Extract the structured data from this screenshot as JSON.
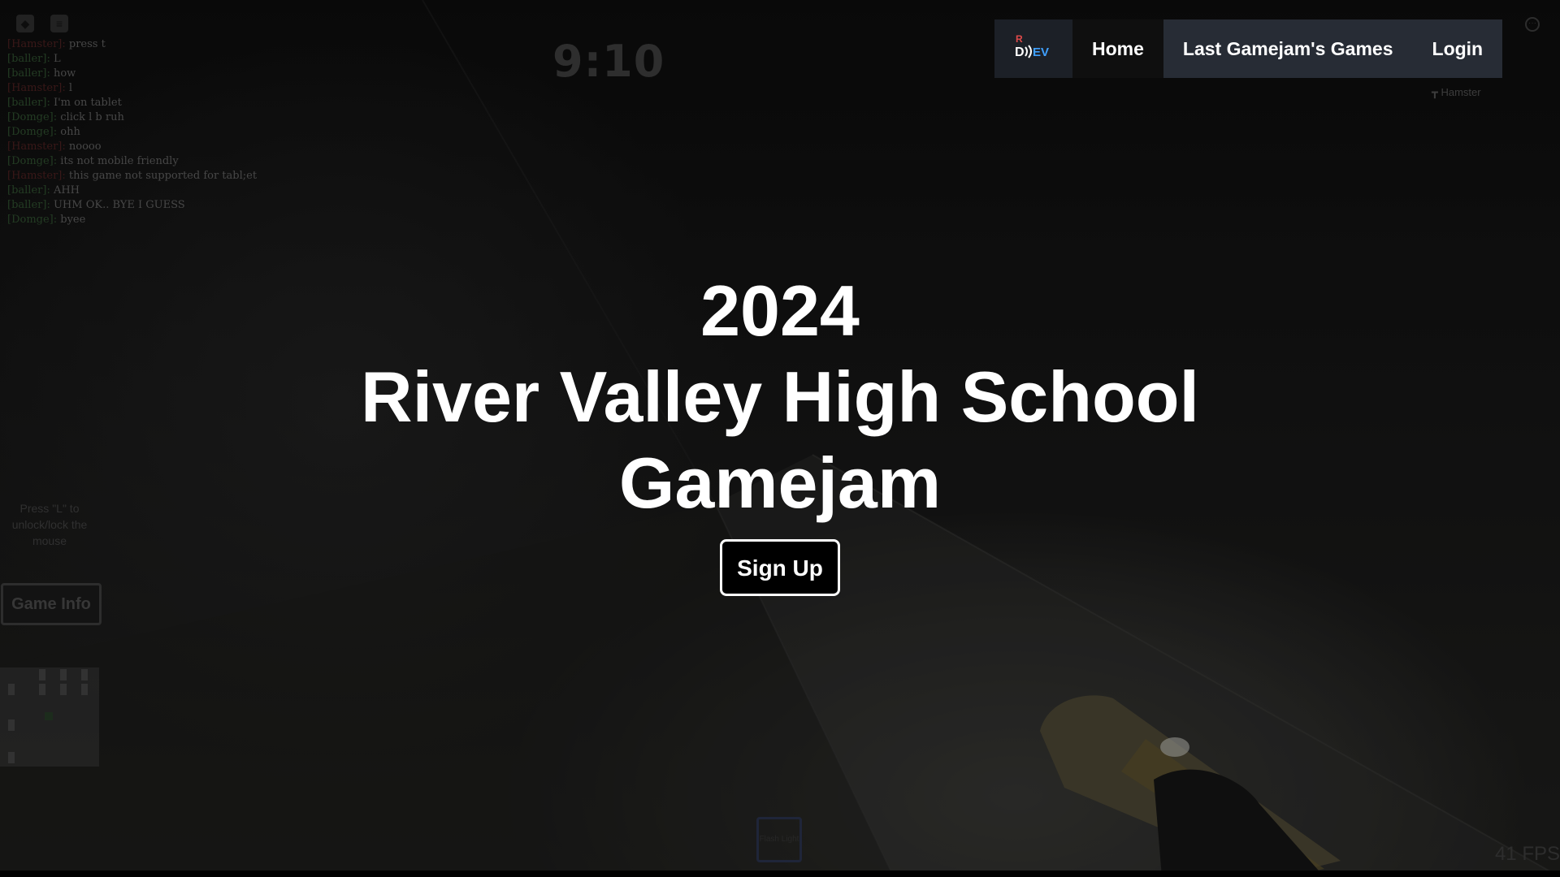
{
  "nav": {
    "logo_label": "R D)EV",
    "items": [
      {
        "label": "Home"
      },
      {
        "label": "Last Gamejam's Games"
      },
      {
        "label": "Login"
      }
    ]
  },
  "hero": {
    "year": "2024",
    "title_line1": "River Valley High School",
    "title_line2": "Gamejam",
    "signup_label": "Sign Up"
  },
  "game_scene": {
    "timer": "9:10",
    "player_tag": "Hamster",
    "chat": [
      {
        "name": "[Hamster]:",
        "text": "press t",
        "color": "red"
      },
      {
        "name": "[baller]:",
        "text": "L",
        "color": "green"
      },
      {
        "name": "[baller]:",
        "text": "how",
        "color": "green"
      },
      {
        "name": "[Hamster]:",
        "text": "l",
        "color": "red"
      },
      {
        "name": "[baller]:",
        "text": "I'm on tablet",
        "color": "green"
      },
      {
        "name": "[Domge]:",
        "text": "click l b ruh",
        "color": "green"
      },
      {
        "name": "[Domge]:",
        "text": "ohh",
        "color": "green"
      },
      {
        "name": "[Hamster]:",
        "text": "noooo",
        "color": "red"
      },
      {
        "name": "[Domge]:",
        "text": "its not mobile friendly",
        "color": "green"
      },
      {
        "name": "[Hamster]:",
        "text": "this game not supported for tabl;et",
        "color": "red"
      },
      {
        "name": "[baller]:",
        "text": "AHH",
        "color": "green"
      },
      {
        "name": "[baller]:",
        "text": "UHM OK.. BYE I GUESS",
        "color": "green"
      },
      {
        "name": "[Domge]:",
        "text": "byee",
        "color": "green"
      }
    ],
    "hint": "Press \"L\" to unlock/lock the mouse",
    "game_info_label": "Game Info",
    "hotbar_label": "Flash Light",
    "fps": "41 FPS"
  }
}
